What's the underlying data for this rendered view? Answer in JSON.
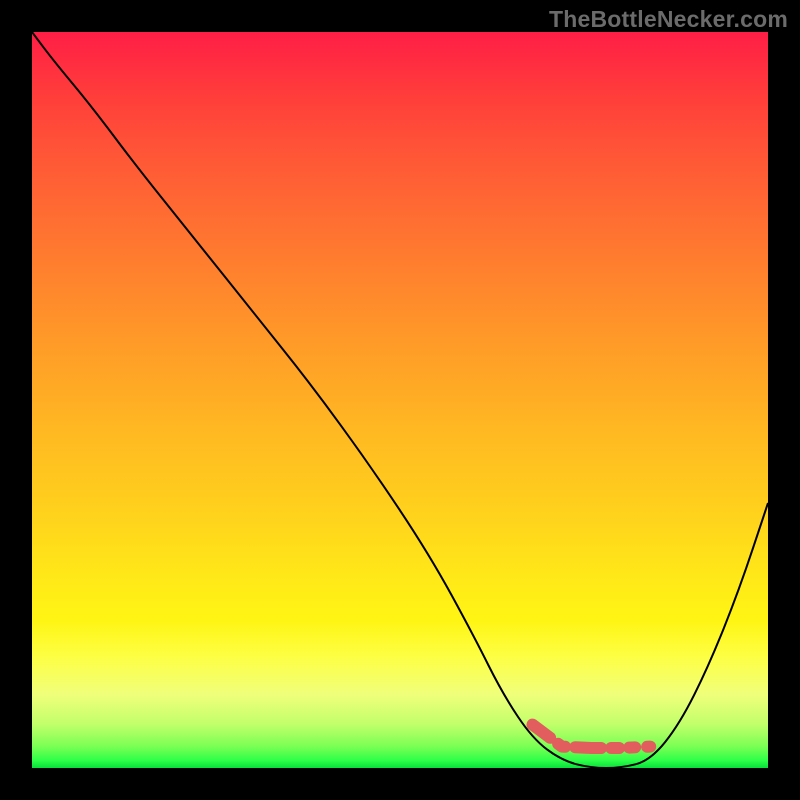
{
  "watermark": {
    "text": "TheBottleNecker.com"
  },
  "colors": {
    "accent_stroke": "#e25d5d",
    "curve_stroke": "#000000",
    "background": "#000000"
  },
  "chart_data": {
    "type": "line",
    "title": "",
    "xlabel": "",
    "ylabel": "",
    "xlim": [
      0,
      100
    ],
    "ylim": [
      0,
      100
    ],
    "grid": false,
    "legend": false,
    "series": [
      {
        "name": "bottleneck-curve",
        "x": [
          0,
          3,
          8,
          14,
          22,
          30,
          38,
          46,
          54,
          60,
          64,
          68,
          72,
          76,
          80,
          84,
          88,
          92,
          96,
          100
        ],
        "values": [
          100,
          96,
          90,
          82,
          72,
          62,
          52,
          41,
          29,
          18,
          10,
          4,
          1,
          0,
          0,
          1,
          6,
          14,
          24,
          36
        ]
      }
    ],
    "annotations": [
      {
        "name": "optimal-range-highlight",
        "x_start": 66,
        "x_end": 84,
        "y_approx": 0
      }
    ]
  }
}
